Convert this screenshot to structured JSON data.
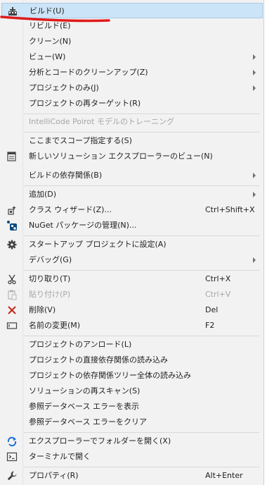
{
  "menu": {
    "items": [
      {
        "label": "ビルド(U)",
        "icon": "build-icon",
        "selected": true
      },
      {
        "label": "リビルド(E)"
      },
      {
        "label": "クリーン(N)"
      },
      {
        "label": "ビュー(W)",
        "submenu": true
      },
      {
        "label": "分析とコードのクリーンアップ(Z)",
        "submenu": true
      },
      {
        "label": "プロジェクトのみ(J)",
        "submenu": true
      },
      {
        "label": "プロジェクトの再ターゲット(R)"
      },
      {
        "label": "IntelliCode Poirot モデルのトレーニング",
        "disabled": true
      },
      {
        "label": "ここまでスコープ指定する(S)"
      },
      {
        "label": "新しいソリューション エクスプローラーのビュー(N)",
        "icon": "new-view-icon"
      },
      {
        "label": "ビルドの依存関係(B)",
        "submenu": true
      },
      {
        "label": "追加(D)",
        "submenu": true
      },
      {
        "label": "クラス ウィザード(Z)...",
        "shortcut": "Ctrl+Shift+X",
        "icon": "class-wizard-icon"
      },
      {
        "label": "NuGet パッケージの管理(N)...",
        "icon": "nuget-icon"
      },
      {
        "label": "スタートアップ プロジェクトに設定(A)",
        "icon": "gear-icon"
      },
      {
        "label": "デバッグ(G)",
        "submenu": true
      },
      {
        "label": "切り取り(T)",
        "shortcut": "Ctrl+X",
        "icon": "scissors-icon"
      },
      {
        "label": "貼り付け(P)",
        "shortcut": "Ctrl+V",
        "icon": "paste-icon",
        "disabled": true
      },
      {
        "label": "削除(V)",
        "shortcut": "Del",
        "icon": "delete-icon"
      },
      {
        "label": "名前の変更(M)",
        "shortcut": "F2",
        "icon": "rename-icon"
      },
      {
        "label": "プロジェクトのアンロード(L)"
      },
      {
        "label": "プロジェクトの直接依存関係の読み込み"
      },
      {
        "label": "プロジェクトの依存関係ツリー全体の読み込み"
      },
      {
        "label": "ソリューションの再スキャン(S)"
      },
      {
        "label": "参照データベース エラーを表示"
      },
      {
        "label": "参照データベース エラーをクリア"
      },
      {
        "label": "エクスプローラーでフォルダーを開く(X)",
        "icon": "refresh-icon"
      },
      {
        "label": "ターミナルで開く",
        "icon": "terminal-icon"
      },
      {
        "label": "プロパティ(R)",
        "shortcut": "Alt+Enter",
        "icon": "wrench-icon"
      }
    ]
  },
  "colors": {
    "menu_bg": "#f2f2f2",
    "selected_bg": "#cce4f7",
    "selected_border": "#a8c9e6",
    "disabled_text": "#a6a6a6",
    "annotation_stroke": "#e01b1b"
  }
}
